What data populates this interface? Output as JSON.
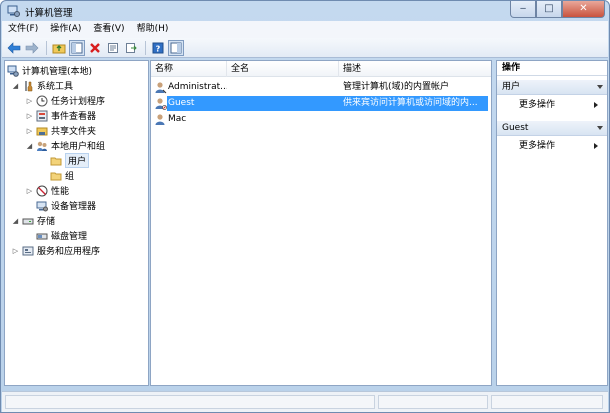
{
  "window": {
    "title": "计算机管理"
  },
  "menubar": {
    "items": [
      "文件(F)",
      "操作(A)",
      "查看(V)",
      "帮助(H)"
    ]
  },
  "toolbar": {
    "buttons": [
      "back-arrow-icon",
      "forward-arrow-icon",
      "up-folder-icon",
      "show-hide-tree-icon",
      "delete-icon",
      "properties-icon",
      "export-list-icon",
      "help-icon",
      "show-hide-action-pane-icon"
    ]
  },
  "tree": {
    "root": "计算机管理(本地)",
    "system_tools": "系统工具",
    "task_scheduler": "任务计划程序",
    "event_viewer": "事件查看器",
    "shared_folders": "共享文件夹",
    "local_users_groups": "本地用户和组",
    "users": "用户",
    "groups": "组",
    "performance": "性能",
    "device_manager": "设备管理器",
    "storage": "存储",
    "disk_management": "磁盘管理",
    "services_apps": "服务和应用程序"
  },
  "list": {
    "columns": [
      "名称",
      "全名",
      "描述"
    ],
    "rows": [
      {
        "name": "Administrat...",
        "fullname": "",
        "description": "管理计算机(域)的内置帐户"
      },
      {
        "name": "Guest",
        "fullname": "",
        "description": "供来宾访问计算机或访问域的内..."
      },
      {
        "name": "Mac",
        "fullname": "",
        "description": ""
      }
    ]
  },
  "actions": {
    "title": "操作",
    "section1": "用户",
    "more1": "更多操作",
    "section2": "Guest",
    "more2": "更多操作"
  },
  "colors": {
    "selection": "#3399ff",
    "window_frame": "#b9d1ea",
    "delete_red": "#d81e1e"
  }
}
